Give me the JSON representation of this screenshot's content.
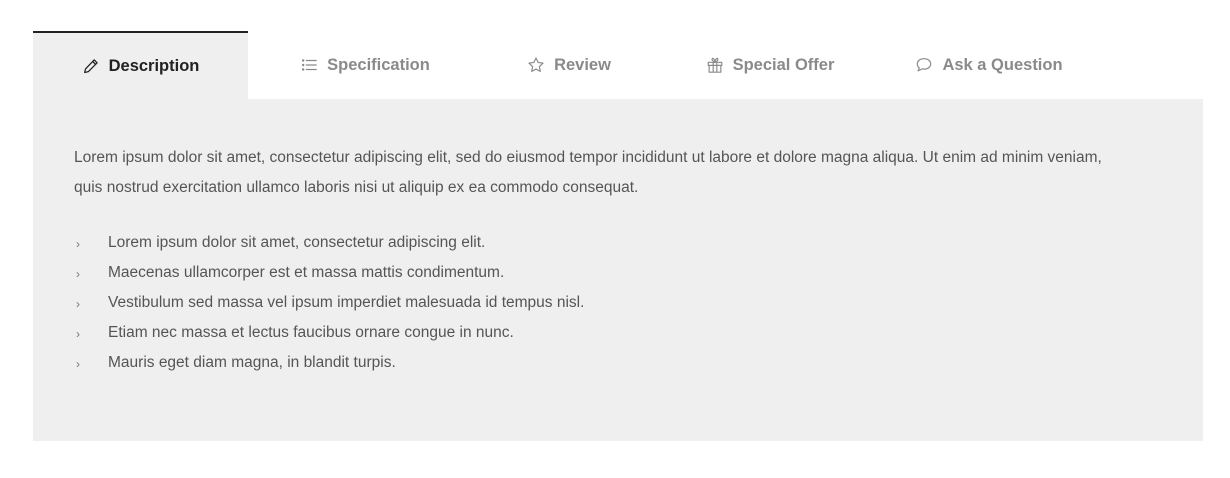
{
  "tabs": [
    {
      "label": "Description",
      "icon": "pencil-icon",
      "active": true
    },
    {
      "label": "Specification",
      "icon": "list-icon",
      "active": false
    },
    {
      "label": "Review",
      "icon": "star-icon",
      "active": false
    },
    {
      "label": "Special Offer",
      "icon": "gift-icon",
      "active": false
    },
    {
      "label": "Ask a Question",
      "icon": "chat-bubble-icon",
      "active": false
    }
  ],
  "panel": {
    "intro": "Lorem ipsum dolor sit amet, consectetur adipiscing elit, sed do eiusmod tempor incididunt ut labore et dolore magna aliqua. Ut enim ad minim veniam, quis nostrud exercitation ullamco laboris nisi ut aliquip ex ea commodo consequat.",
    "bullet_marker": "›",
    "bullets": [
      "Lorem ipsum dolor sit amet, consectetur adipiscing elit.",
      "Maecenas ullamcorper est et massa mattis condimentum.",
      "Vestibulum sed massa vel ipsum imperdiet malesuada id tempus nisl.",
      "Etiam nec massa et lectus faucibus ornare congue in nunc.",
      "Mauris eget diam magna, in blandit turpis."
    ]
  },
  "colors": {
    "panel_bg": "#efefef",
    "active_text": "#222222",
    "inactive_text": "#8a8a8a",
    "body_text": "#555555"
  }
}
